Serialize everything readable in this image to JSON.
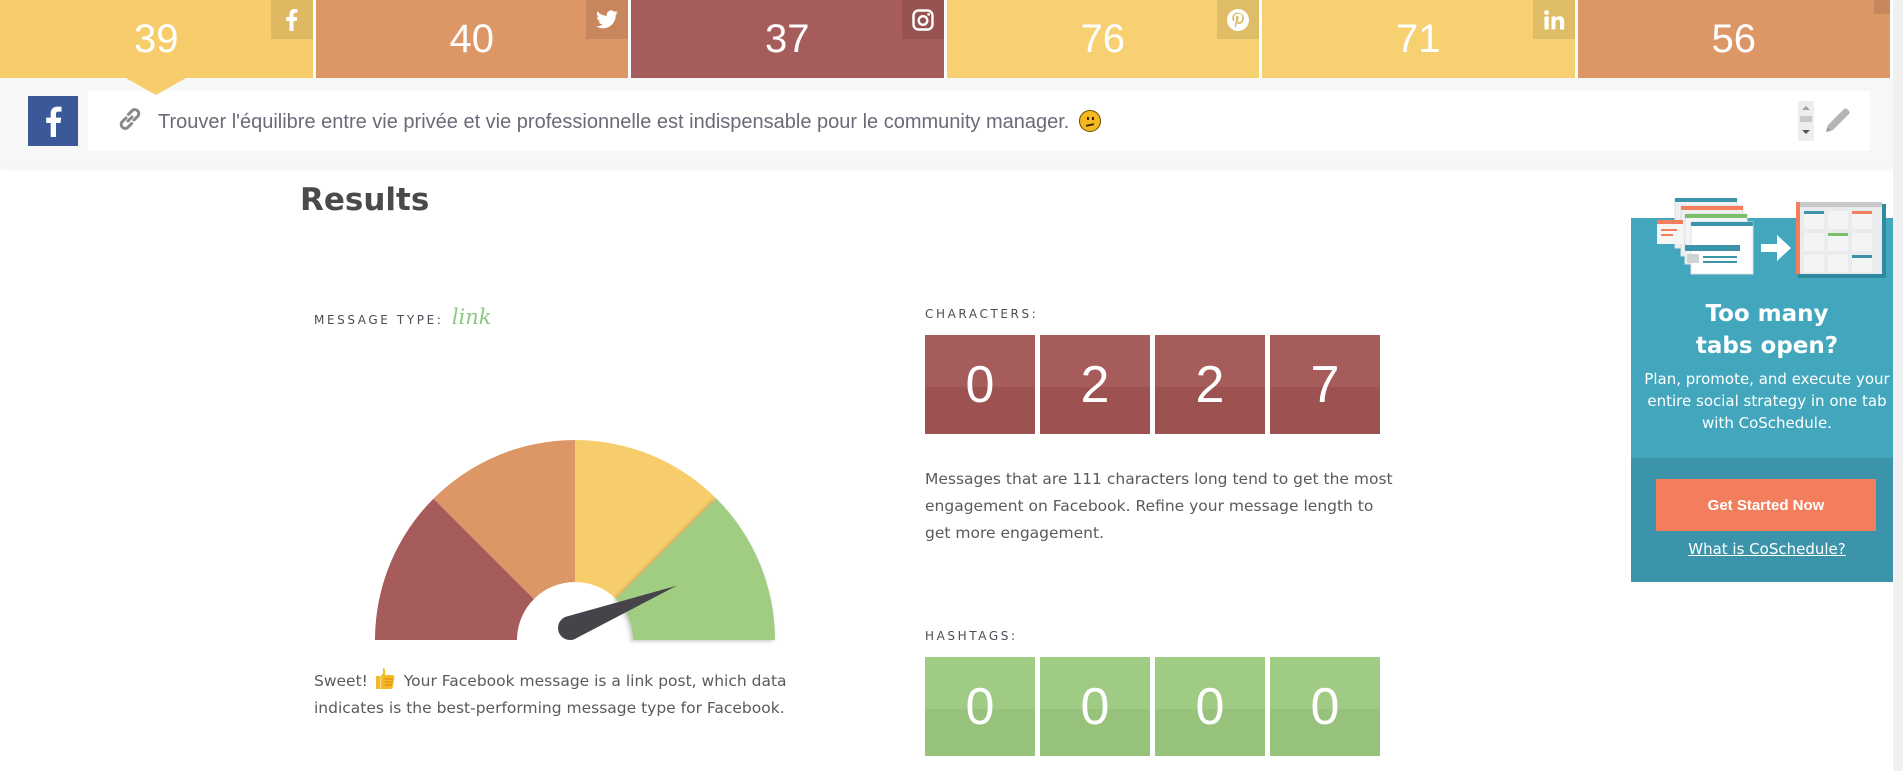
{
  "scores": [
    {
      "network": "facebook",
      "icon": "facebook-icon",
      "value": "39",
      "color": "#f6cd6a",
      "icon_bg": "#dfb962",
      "active": true
    },
    {
      "network": "twitter",
      "icon": "twitter-icon",
      "value": "40",
      "color": "#dd9665",
      "icon_bg": "#c8865c",
      "active": false
    },
    {
      "network": "instagram",
      "icon": "instagram-icon",
      "value": "37",
      "color": "#a65c5b",
      "icon_bg": "#965352",
      "active": false
    },
    {
      "network": "pinterest",
      "icon": "pinterest-icon",
      "value": "76",
      "color": "#f6d071",
      "icon_bg": "#dfbc66",
      "active": false
    },
    {
      "network": "linkedin",
      "icon": "linkedin-icon",
      "value": "71",
      "color": "#f6d071",
      "icon_bg": "#dfbc66",
      "active": false
    },
    {
      "network": "other",
      "icon": "network-icon",
      "value": "56",
      "color": "#dd9665",
      "icon_bg": "#c8865c",
      "active": false
    }
  ],
  "composer": {
    "network": "Facebook",
    "message": "Trouver l'équilibre entre vie privée et vie professionnelle est indispensable pour le community manager.",
    "emoji": "thinking-face"
  },
  "results": {
    "title": "Results",
    "message_type": {
      "label": "MESSAGE TYPE:",
      "value": "link",
      "gauge_segments": [
        "#a65c5b",
        "#dd9665",
        "#f6cd6a",
        "#a0cd82"
      ],
      "needle_color": "#46434a",
      "gauge_value_fraction": 0.9,
      "text_prefix": "Sweet!",
      "text": "Your Facebook message is a link post, which data indicates is the best-performing message type for Facebook."
    },
    "characters": {
      "label": "CHARACTERS:",
      "digits": [
        "0",
        "2",
        "2",
        "7"
      ],
      "color_top": "#a65c5b",
      "color_bottom": "#9d5251",
      "text": "Messages that are 111 characters long tend to get the most engagement on Facebook. Refine your message length to get more engagement."
    },
    "hashtags": {
      "label": "HASHTAGS:",
      "digits": [
        "0",
        "0",
        "0",
        "0"
      ],
      "color_top": "#a0cb84",
      "color_bottom": "#96c27b"
    }
  },
  "ad": {
    "title_line1": "Too many",
    "title_line2": "tabs open?",
    "subtitle": "Plan, promote, and execute your entire social strategy in one tab with CoSchedule.",
    "button_label": "Get Started Now",
    "link_label": "What is CoSchedule?"
  }
}
